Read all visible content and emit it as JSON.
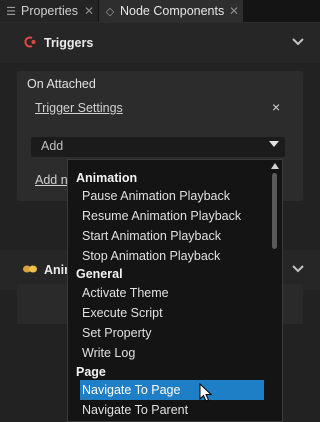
{
  "tabs": [
    {
      "label": "Properties",
      "icon": "list-icon"
    },
    {
      "label": "Node Components",
      "icon": "node-components-icon"
    }
  ],
  "triggers_section": {
    "title": "Triggers",
    "icon": "trigger-icon"
  },
  "card": {
    "title": "On Attached",
    "trigger_settings_link": "Trigger Settings",
    "remove_label": "×",
    "add_dropdown_value": "Add",
    "add_node_link_partial": "Add n"
  },
  "animations_section": {
    "title_partial": "Anim",
    "icon": "animation-icon"
  },
  "dropdown_menu": {
    "groups": [
      {
        "category": "Animation",
        "items": [
          "Pause Animation Playback",
          "Resume Animation Playback",
          "Start Animation Playback",
          "Stop Animation Playback"
        ]
      },
      {
        "category": "General",
        "items": [
          "Activate Theme",
          "Execute Script",
          "Set Property",
          "Write Log"
        ]
      },
      {
        "category": "Page",
        "items": [
          "Navigate To Page",
          "Navigate To Parent"
        ]
      }
    ],
    "selected": "Navigate To Page"
  },
  "colors": {
    "accent_selection": "#1f7fc6",
    "background": "#1f1f1f"
  }
}
